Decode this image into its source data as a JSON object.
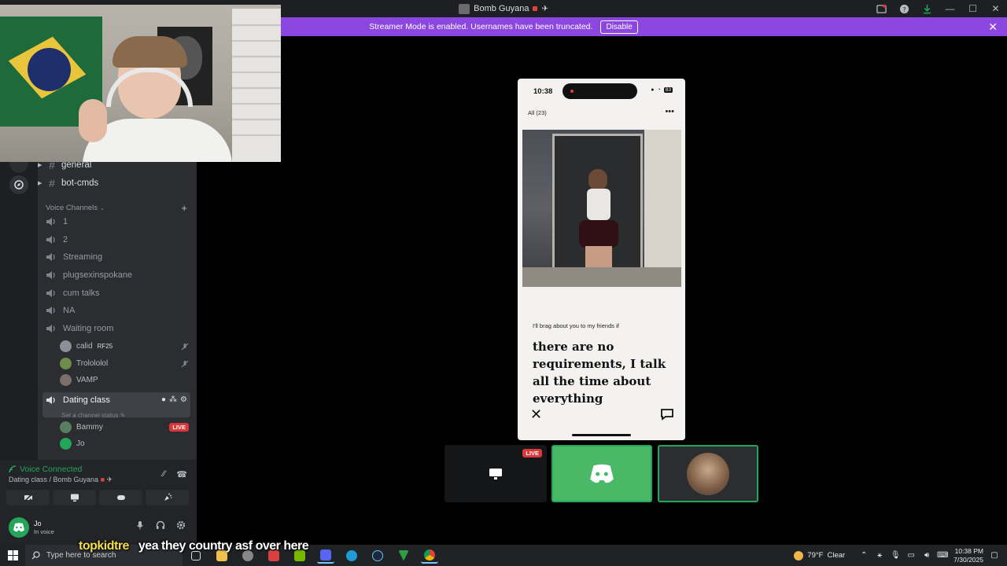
{
  "window": {
    "title": "Bomb Guyana",
    "streamer_banner": "Streamer Mode is enabled. Usernames have been truncated.",
    "disable_label": "Disable"
  },
  "channels": {
    "text": [
      {
        "name": "general"
      },
      {
        "name": "bot-cmds"
      }
    ],
    "voice_header": "Voice Channels",
    "voice": [
      {
        "name": "1"
      },
      {
        "name": "2"
      },
      {
        "name": "Streaming"
      },
      {
        "name": "plugsexinspokane"
      },
      {
        "name": "cum talks"
      },
      {
        "name": "NA"
      },
      {
        "name": "Waiting room"
      }
    ],
    "waiting_users": [
      {
        "name": "calid",
        "tag": "RF25"
      },
      {
        "name": "Trolololol",
        "tag": ""
      },
      {
        "name": "VAMP",
        "tag": ""
      }
    ],
    "active_channel": {
      "name": "Dating class",
      "status_placeholder": "Set a channel status",
      "users": [
        {
          "name": "Bammy",
          "live": "LIVE"
        },
        {
          "name": "Jo",
          "live": ""
        }
      ]
    }
  },
  "voice_panel": {
    "title": "Voice Connected",
    "subtitle": "Dating class / Bomb Guyana"
  },
  "user_panel": {
    "name": "Jo",
    "status": "In voice"
  },
  "phone": {
    "time": "10:38",
    "battery": "83",
    "filter": "All (23)",
    "prompt": "I'll brag about you to my friends if",
    "answer": "there are no requirements, I talk all the time about everything"
  },
  "tiles": {
    "live_label": "LIVE"
  },
  "caption": {
    "speaker": "topkidtre",
    "text": "yea they country asf over here"
  },
  "taskbar": {
    "search_placeholder": "Type here to search",
    "weather": "79°F",
    "weather_desc": "Clear",
    "time": "10:38 PM",
    "date": "7/30/2025"
  },
  "colors": {
    "banner": "#8c47e0",
    "green": "#23a55a",
    "live": "#da373c"
  }
}
